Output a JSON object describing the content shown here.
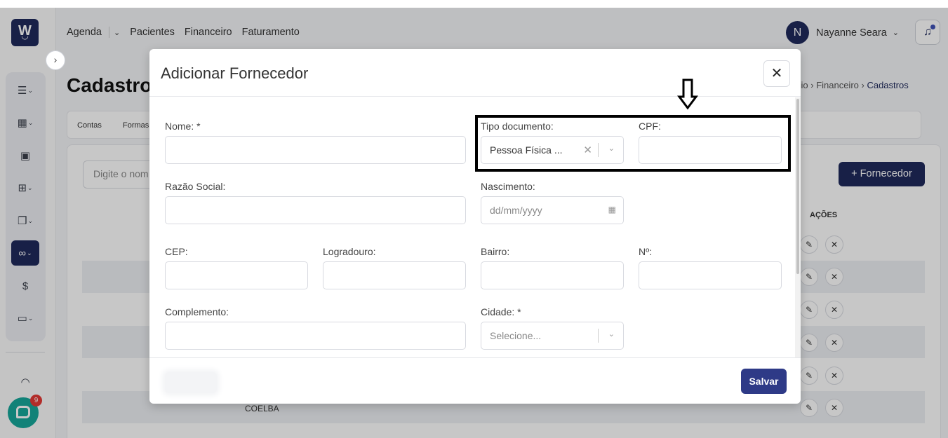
{
  "sidebar": {
    "logo": "W",
    "toggle_icon": "chevron-right-icon",
    "items": [
      {
        "icon": "list-icon",
        "glyph": "☰"
      },
      {
        "icon": "calendar-icon",
        "glyph": "▦"
      },
      {
        "icon": "contact-icon",
        "glyph": "▣"
      },
      {
        "icon": "medical-bag-icon",
        "glyph": "⊞"
      },
      {
        "icon": "documents-icon",
        "glyph": "❐"
      },
      {
        "icon": "handshake-icon",
        "glyph": "∞"
      },
      {
        "icon": "money-icon",
        "glyph": "$"
      },
      {
        "icon": "monitor-icon",
        "glyph": "▭"
      }
    ],
    "support_icon": "headset-icon",
    "chat_badge": "9"
  },
  "header": {
    "nav": [
      "Agenda",
      "Pacientes",
      "Financeiro",
      "Faturamento"
    ],
    "user_initial": "N",
    "user_name": "Nayanne Seara"
  },
  "page": {
    "title": "Cadastro",
    "breadcrumb": [
      "cio",
      "Financeiro",
      "Cadastros"
    ],
    "tabs": [
      "Contas",
      "Formas"
    ],
    "search_placeholder": "Digite o nom",
    "add_button": "Fornecedor",
    "actions_header": "AÇÕES",
    "visible_row_text": "COELBA"
  },
  "modal": {
    "title": "Adicionar Fornecedor",
    "fields": {
      "nome": {
        "label": "Nome: *",
        "value": ""
      },
      "tipo_documento": {
        "label": "Tipo documento:",
        "value": "Pessoa Física ..."
      },
      "cpf": {
        "label": "CPF:",
        "value": ""
      },
      "razao_social": {
        "label": "Razão Social:",
        "value": ""
      },
      "nascimento": {
        "label": "Nascimento:",
        "placeholder": "dd/mm/yyyy"
      },
      "cep": {
        "label": "CEP:",
        "value": ""
      },
      "logradouro": {
        "label": "Logradouro:",
        "value": ""
      },
      "bairro": {
        "label": "Bairro:",
        "value": ""
      },
      "numero": {
        "label": "Nº:",
        "value": ""
      },
      "complemento": {
        "label": "Complemento:",
        "value": ""
      },
      "cidade": {
        "label": "Cidade: *",
        "placeholder": "Selecione..."
      }
    },
    "save_button": "Salvar"
  }
}
